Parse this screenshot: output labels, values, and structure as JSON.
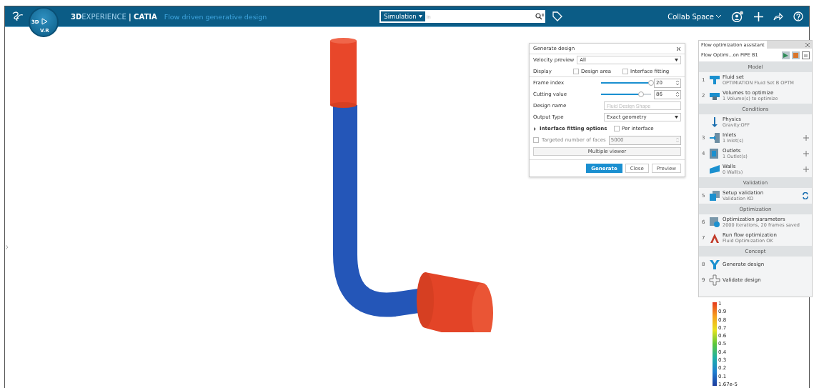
{
  "topbar": {
    "brand": "**3D**EXPERIENCE **| CATIA**",
    "app_title": "Flow driven generative design",
    "compass_labels": [
      "3D",
      "V.R"
    ],
    "search": {
      "scope": "Simulation",
      "placeholder": "in"
    },
    "collab_space": "Collab Space"
  },
  "dialog": {
    "title": "Generate design",
    "velocity_preview": {
      "label": "Velocity preview",
      "value": "All"
    },
    "display": {
      "label": "Display",
      "options": [
        {
          "label": "Design area",
          "checked": false
        },
        {
          "label": "Interface fitting",
          "checked": false
        }
      ]
    },
    "sliders": [
      {
        "label": "Frame index",
        "level": 1.0,
        "value": "20"
      },
      {
        "label": "Cutting value",
        "level": 0.8,
        "value": "86"
      }
    ],
    "design_name": {
      "label": "Design name",
      "placeholder": "Fluid Design Shape"
    },
    "output_type": {
      "label": "Output Type",
      "value": "Exact geometry"
    },
    "interface_fitting": {
      "label": "Interface fitting options",
      "expanded": false,
      "option": {
        "label": "Per interface",
        "checked": false
      }
    },
    "targeted_faces": {
      "label": "Targeted number of faces",
      "checked": false,
      "value": "5000"
    },
    "multiple_viewer": "Multiple viewer",
    "buttons": [
      {
        "label": "Generate",
        "kind": "primary"
      },
      {
        "label": "Close",
        "kind": "secondary"
      },
      {
        "label": "Preview",
        "kind": "secondary"
      }
    ]
  },
  "assistant": {
    "title": "Flow optimization assistant",
    "subtitle": "Flow Optimi...on PIPE B1",
    "sections": [
      {
        "title": "Model",
        "items": [
          {
            "number": "1",
            "title": "Fluid set",
            "subtitle": "OPTIMIATION Fluid Set B OPTM"
          },
          {
            "number": "2",
            "title": "Volumes to optimize",
            "subtitle": "1 Volume(s) to optimize"
          }
        ]
      },
      {
        "title": "Conditions",
        "items": [
          {
            "title": "Physics",
            "subtitle": "Gravity:OFF"
          },
          {
            "number": "3",
            "title": "Inlets",
            "subtitle": "1 Inlet(s)",
            "add_button": true
          },
          {
            "number": "4",
            "title": "Outlets",
            "subtitle": "1 Outlet(s)",
            "add_button": true
          },
          {
            "title": "Walls",
            "subtitle": "0 Wall(s)",
            "add_button": true
          }
        ]
      },
      {
        "title": "Validation",
        "items": [
          {
            "number": "5",
            "title": "Setup validation",
            "subtitle": "Validation KO",
            "refresh_button": true
          }
        ]
      },
      {
        "title": "Optimization",
        "items": [
          {
            "number": "6",
            "title": "Optimization parameters",
            "subtitle": "2000 iterations, 20 frames saved"
          },
          {
            "number": "7",
            "title": "Run flow optimization",
            "subtitle": "Fluid Optimization OK"
          }
        ]
      },
      {
        "title": "Concept",
        "items": [
          {
            "number": "8",
            "title": "Generate design"
          },
          {
            "number": "9",
            "title": "Validate design"
          }
        ]
      }
    ]
  },
  "legend": {
    "ticks": [
      "1",
      "0.9",
      "0.8",
      "0.7",
      "0.6",
      "0.5",
      "0.4",
      "0.3",
      "0.2",
      "0.1",
      "1.67e-5"
    ]
  }
}
